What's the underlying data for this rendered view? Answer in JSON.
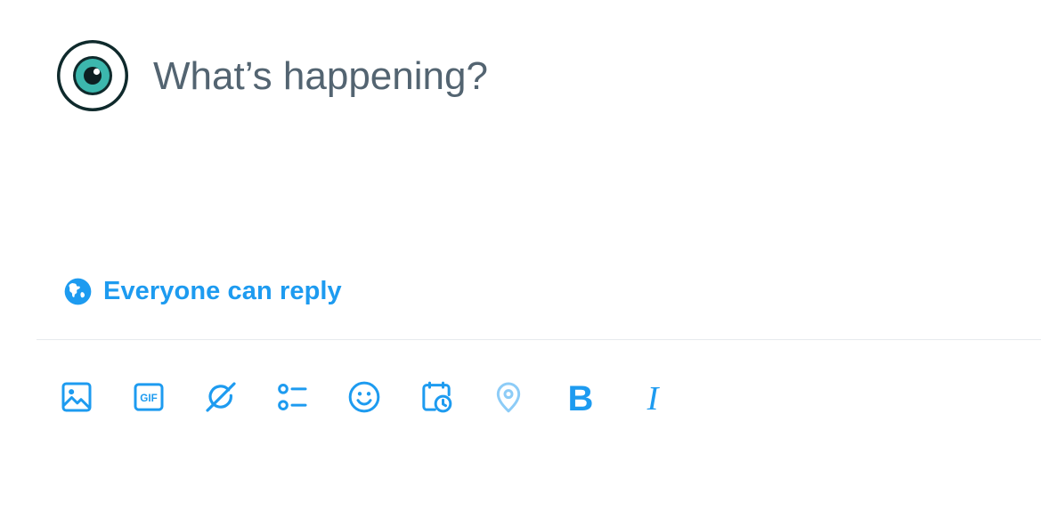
{
  "composer": {
    "placeholder": "What’s happening?",
    "reply_setting_label": "Everyone can reply",
    "accent_color": "#1d9bf0",
    "placeholder_color": "#536471",
    "avatar_icon": "eye-icon"
  },
  "toolbar": {
    "items": [
      {
        "name": "media",
        "icon": "image-icon"
      },
      {
        "name": "gif",
        "icon": "gif-icon",
        "label": "GIF"
      },
      {
        "name": "grok",
        "icon": "grok-icon"
      },
      {
        "name": "poll",
        "icon": "poll-icon"
      },
      {
        "name": "emoji",
        "icon": "emoji-icon"
      },
      {
        "name": "schedule",
        "icon": "schedule-icon"
      },
      {
        "name": "location",
        "icon": "location-icon",
        "disabled": true
      },
      {
        "name": "bold",
        "icon": "bold-icon",
        "label": "B"
      },
      {
        "name": "italic",
        "icon": "italic-icon",
        "label": "I"
      }
    ]
  }
}
